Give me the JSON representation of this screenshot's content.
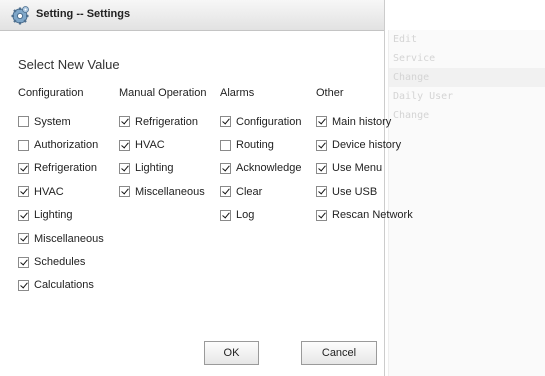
{
  "background_menu": [
    "Edit",
    "Service",
    "Change",
    "Daily User",
    "Change"
  ],
  "dialog": {
    "title": "Setting -- Settings",
    "subtitle": "Select New Value",
    "ok_label": "OK",
    "cancel_label": "Cancel"
  },
  "columns": [
    {
      "header": "Configuration",
      "items": [
        {
          "label": "System",
          "checked": false
        },
        {
          "label": "Authorization",
          "checked": false
        },
        {
          "label": "Refrigeration",
          "checked": true
        },
        {
          "label": "HVAC",
          "checked": true
        },
        {
          "label": "Lighting",
          "checked": true
        },
        {
          "label": "Miscellaneous",
          "checked": true
        },
        {
          "label": "Schedules",
          "checked": true
        },
        {
          "label": "Calculations",
          "checked": true
        }
      ]
    },
    {
      "header": "Manual Operation",
      "items": [
        {
          "label": "Refrigeration",
          "checked": true
        },
        {
          "label": "HVAC",
          "checked": true
        },
        {
          "label": "Lighting",
          "checked": true
        },
        {
          "label": "Miscellaneous",
          "checked": true
        }
      ]
    },
    {
      "header": "Alarms",
      "items": [
        {
          "label": "Configuration",
          "checked": true
        },
        {
          "label": "Routing",
          "checked": false
        },
        {
          "label": "Acknowledge",
          "checked": true
        },
        {
          "label": "Clear",
          "checked": true
        },
        {
          "label": "Log",
          "checked": true
        }
      ]
    },
    {
      "header": "Other",
      "items": [
        {
          "label": "Main history",
          "checked": true
        },
        {
          "label": "Device history",
          "checked": true
        },
        {
          "label": "Use Menu",
          "checked": true
        },
        {
          "label": "Use USB",
          "checked": true
        },
        {
          "label": "Rescan Network",
          "checked": true
        }
      ]
    }
  ]
}
